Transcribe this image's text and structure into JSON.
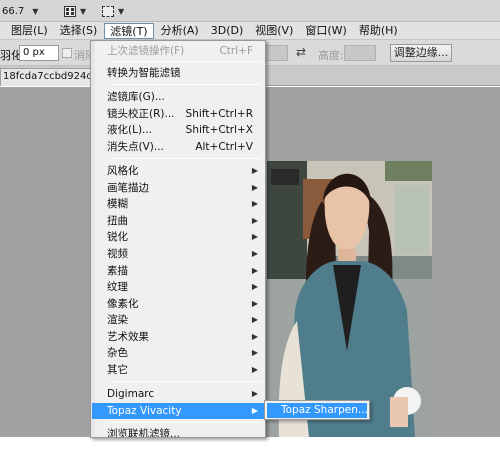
{
  "topbar": {
    "zoom": "66.7"
  },
  "menubar": {
    "items": [
      "图层(L)",
      "选择(S)",
      "滤镜(T)",
      "分析(A)",
      "3D(D)",
      "视图(V)",
      "窗口(W)",
      "帮助(H)"
    ]
  },
  "options": {
    "feather_label": "羽化:",
    "feather_value": "0 px",
    "antialias_label": "消除",
    "height_label": "高度:",
    "refine_button": "调整边缘..."
  },
  "document": {
    "tab_title": "18fcda7ccbd924c.jpg"
  },
  "filter_menu": {
    "items": [
      {
        "label": "上次滤镜操作(F)",
        "shortcut": "Ctrl+F",
        "disabled": true
      },
      {
        "label": "转换为智能滤镜"
      },
      {
        "label": "滤镜库(G)..."
      },
      {
        "label": "镜头校正(R)...",
        "shortcut": "Shift+Ctrl+R"
      },
      {
        "label": "液化(L)...",
        "shortcut": "Shift+Ctrl+X"
      },
      {
        "label": "消失点(V)...",
        "shortcut": "Alt+Ctrl+V"
      },
      {
        "label": "风格化",
        "submenu": true
      },
      {
        "label": "画笔描边",
        "submenu": true
      },
      {
        "label": "模糊",
        "submenu": true
      },
      {
        "label": "扭曲",
        "submenu": true
      },
      {
        "label": "锐化",
        "submenu": true
      },
      {
        "label": "视频",
        "submenu": true
      },
      {
        "label": "素描",
        "submenu": true
      },
      {
        "label": "纹理",
        "submenu": true
      },
      {
        "label": "像素化",
        "submenu": true
      },
      {
        "label": "渲染",
        "submenu": true
      },
      {
        "label": "艺术效果",
        "submenu": true
      },
      {
        "label": "杂色",
        "submenu": true
      },
      {
        "label": "其它",
        "submenu": true
      },
      {
        "label": "Digimarc",
        "submenu": true
      },
      {
        "label": "Topaz Vivacity",
        "submenu": true,
        "selected": true
      },
      {
        "label": "浏览联机滤镜..."
      }
    ]
  },
  "submenu": {
    "item": "Topaz Sharpen..."
  },
  "colors": {
    "selection": "#3399ff",
    "canvas": "#a2a2a2",
    "menu_bg": "#f0f0f0"
  },
  "icons": {
    "zoom_arrow": "chevron-down",
    "arrange": "arrange-documents-icon",
    "screen_mode": "screen-mode-icon",
    "swap": "swap-arrows-icon",
    "submenu_arrow": "▸"
  }
}
